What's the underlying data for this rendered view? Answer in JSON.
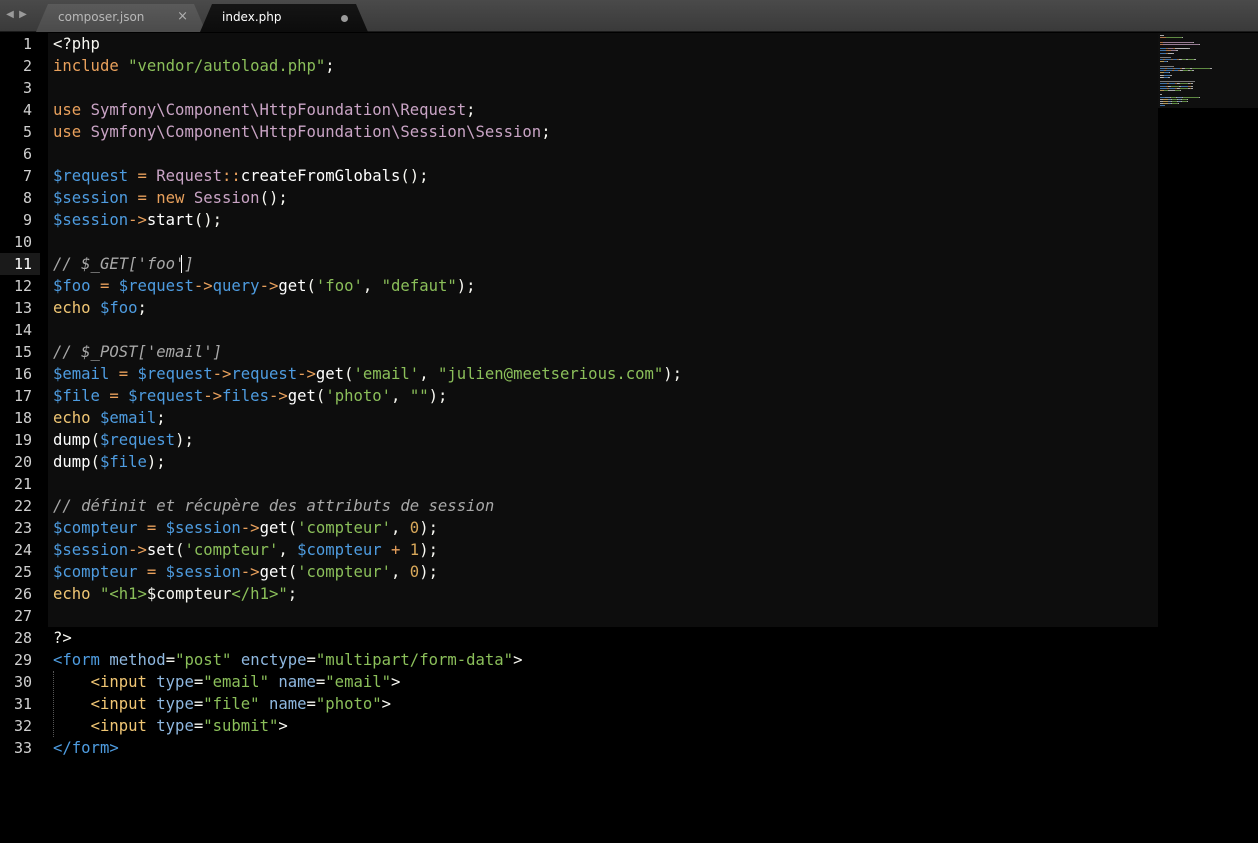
{
  "tabs": [
    {
      "label": "composer.json",
      "close_glyph": "×",
      "active": false
    },
    {
      "label": "index.php",
      "active": true,
      "dirty": true
    }
  ],
  "nav": {
    "back_icon": "◀",
    "forward_icon": "▶"
  },
  "editor": {
    "current_line": 11,
    "line_numbers": [
      "1",
      "2",
      "3",
      "4",
      "5",
      "6",
      "7",
      "8",
      "9",
      "10",
      "11",
      "12",
      "13",
      "14",
      "15",
      "16",
      "17",
      "18",
      "19",
      "20",
      "21",
      "22",
      "23",
      "24",
      "25",
      "26",
      "27",
      "28",
      "29",
      "30",
      "31",
      "32",
      "33"
    ],
    "lines": [
      [
        [
          "dflt",
          "<?php"
        ]
      ],
      [
        [
          "kw2",
          "include "
        ],
        [
          "str",
          "\"vendor/autoload.php\""
        ],
        [
          "dflt",
          ";"
        ]
      ],
      [],
      [
        [
          "kw2",
          "use "
        ],
        [
          "cls",
          "Symfony\\Component\\HttpFoundation\\Request"
        ],
        [
          "dflt",
          ";"
        ]
      ],
      [
        [
          "kw2",
          "use "
        ],
        [
          "cls",
          "Symfony\\Component\\HttpFoundation\\Session\\Session"
        ],
        [
          "dflt",
          ";"
        ]
      ],
      [],
      [
        [
          "var",
          "$request"
        ],
        [
          "op",
          " = "
        ],
        [
          "cls",
          "Request"
        ],
        [
          "op",
          "::"
        ],
        [
          "fn",
          "createFromGlobals"
        ],
        [
          "dflt",
          "();"
        ]
      ],
      [
        [
          "var",
          "$session"
        ],
        [
          "op",
          " = "
        ],
        [
          "kw2",
          "new "
        ],
        [
          "cls",
          "Session"
        ],
        [
          "dflt",
          "();"
        ]
      ],
      [
        [
          "var",
          "$session"
        ],
        [
          "op",
          "->"
        ],
        [
          "fn",
          "start"
        ],
        [
          "dflt",
          "();"
        ]
      ],
      [],
      [
        [
          "cmt",
          "// $_GET['foo']"
        ]
      ],
      [
        [
          "var",
          "$foo"
        ],
        [
          "op",
          " = "
        ],
        [
          "var",
          "$request"
        ],
        [
          "op",
          "->"
        ],
        [
          "var",
          "query"
        ],
        [
          "op",
          "->"
        ],
        [
          "fn",
          "get"
        ],
        [
          "dflt",
          "("
        ],
        [
          "str",
          "'foo'"
        ],
        [
          "dflt",
          ", "
        ],
        [
          "str",
          "\"defaut\""
        ],
        [
          "dflt",
          ");"
        ]
      ],
      [
        [
          "kw",
          "echo "
        ],
        [
          "var",
          "$foo"
        ],
        [
          "dflt",
          ";"
        ]
      ],
      [],
      [
        [
          "cmt",
          "// $_POST['email']"
        ]
      ],
      [
        [
          "var",
          "$email"
        ],
        [
          "op",
          " = "
        ],
        [
          "var",
          "$request"
        ],
        [
          "op",
          "->"
        ],
        [
          "var",
          "request"
        ],
        [
          "op",
          "->"
        ],
        [
          "fn",
          "get"
        ],
        [
          "dflt",
          "("
        ],
        [
          "str",
          "'email'"
        ],
        [
          "dflt",
          ", "
        ],
        [
          "str",
          "\"julien@meetserious.com\""
        ],
        [
          "dflt",
          ");"
        ]
      ],
      [
        [
          "var",
          "$file"
        ],
        [
          "op",
          " = "
        ],
        [
          "var",
          "$request"
        ],
        [
          "op",
          "->"
        ],
        [
          "var",
          "files"
        ],
        [
          "op",
          "->"
        ],
        [
          "fn",
          "get"
        ],
        [
          "dflt",
          "("
        ],
        [
          "str",
          "'photo'"
        ],
        [
          "dflt",
          ", "
        ],
        [
          "str",
          "\"\""
        ],
        [
          "dflt",
          ");"
        ]
      ],
      [
        [
          "kw",
          "echo "
        ],
        [
          "var",
          "$email"
        ],
        [
          "dflt",
          ";"
        ]
      ],
      [
        [
          "fn",
          "dump"
        ],
        [
          "dflt",
          "("
        ],
        [
          "var",
          "$request"
        ],
        [
          "dflt",
          ");"
        ]
      ],
      [
        [
          "fn",
          "dump"
        ],
        [
          "dflt",
          "("
        ],
        [
          "var",
          "$file"
        ],
        [
          "dflt",
          ");"
        ]
      ],
      [],
      [
        [
          "cmt",
          "// définit et récupère des attributs de session"
        ]
      ],
      [
        [
          "var",
          "$compteur"
        ],
        [
          "op",
          " = "
        ],
        [
          "var",
          "$session"
        ],
        [
          "op",
          "->"
        ],
        [
          "fn",
          "get"
        ],
        [
          "dflt",
          "("
        ],
        [
          "str",
          "'compteur'"
        ],
        [
          "dflt",
          ", "
        ],
        [
          "num",
          "0"
        ],
        [
          "dflt",
          ");"
        ]
      ],
      [
        [
          "var",
          "$session"
        ],
        [
          "op",
          "->"
        ],
        [
          "fn",
          "set"
        ],
        [
          "dflt",
          "("
        ],
        [
          "str",
          "'compteur'"
        ],
        [
          "dflt",
          ", "
        ],
        [
          "var",
          "$compteur"
        ],
        [
          "op",
          " + "
        ],
        [
          "num",
          "1"
        ],
        [
          "dflt",
          ");"
        ]
      ],
      [
        [
          "var",
          "$compteur"
        ],
        [
          "op",
          " = "
        ],
        [
          "var",
          "$session"
        ],
        [
          "op",
          "->"
        ],
        [
          "fn",
          "get"
        ],
        [
          "dflt",
          "("
        ],
        [
          "str",
          "'compteur'"
        ],
        [
          "dflt",
          ", "
        ],
        [
          "num",
          "0"
        ],
        [
          "dflt",
          ");"
        ]
      ],
      [
        [
          "kw",
          "echo "
        ],
        [
          "str",
          "\"<h1>"
        ],
        [
          "dflt",
          "$compteur"
        ],
        [
          "str",
          "</h1>\""
        ],
        [
          "dflt",
          ";"
        ]
      ],
      [],
      [
        [
          "dflt",
          "?>"
        ]
      ],
      [
        [
          "var",
          "<form "
        ],
        [
          "atr",
          "method"
        ],
        [
          "dflt",
          "="
        ],
        [
          "str",
          "\"post\""
        ],
        [
          "dflt",
          " "
        ],
        [
          "atr",
          "enctype"
        ],
        [
          "dflt",
          "="
        ],
        [
          "str",
          "\"multipart/form-data\""
        ],
        [
          "dflt",
          ">"
        ]
      ],
      [
        [
          "dflt",
          "    "
        ],
        [
          "tag",
          "<input "
        ],
        [
          "atr",
          "type"
        ],
        [
          "dflt",
          "="
        ],
        [
          "str",
          "\"email\""
        ],
        [
          "dflt",
          " "
        ],
        [
          "atr",
          "name"
        ],
        [
          "dflt",
          "="
        ],
        [
          "str",
          "\"email\""
        ],
        [
          "dflt",
          ">"
        ]
      ],
      [
        [
          "dflt",
          "    "
        ],
        [
          "tag",
          "<input "
        ],
        [
          "atr",
          "type"
        ],
        [
          "dflt",
          "="
        ],
        [
          "str",
          "\"file\""
        ],
        [
          "dflt",
          " "
        ],
        [
          "atr",
          "name"
        ],
        [
          "dflt",
          "="
        ],
        [
          "str",
          "\"photo\""
        ],
        [
          "dflt",
          ">"
        ]
      ],
      [
        [
          "dflt",
          "    "
        ],
        [
          "tag",
          "<input "
        ],
        [
          "atr",
          "type"
        ],
        [
          "dflt",
          "="
        ],
        [
          "str",
          "\"submit\""
        ],
        [
          "dflt",
          ">"
        ]
      ],
      [
        [
          "var",
          "</form>"
        ]
      ]
    ]
  }
}
